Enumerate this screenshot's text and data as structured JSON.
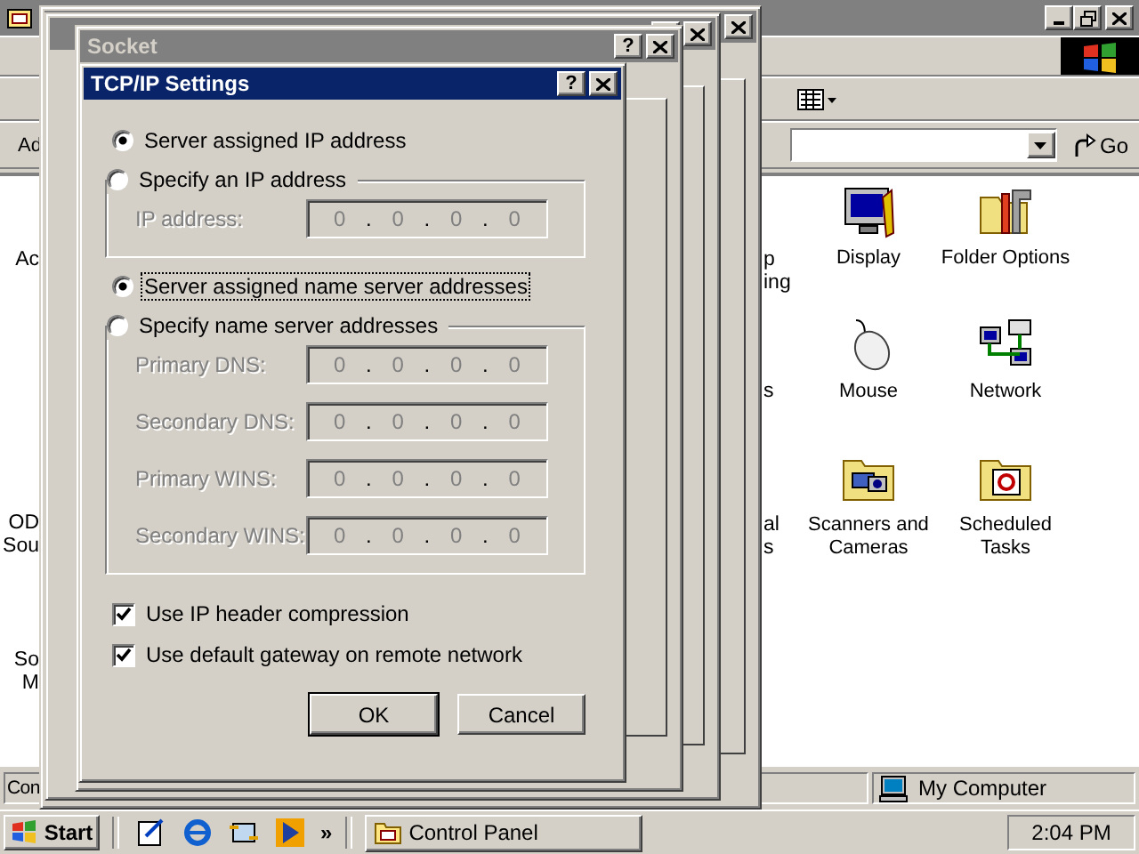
{
  "explorer": {
    "address_label": "Ad",
    "go_button": "Go",
    "icons": [
      {
        "kind": "display",
        "label": "Display"
      },
      {
        "kind": "folder-options",
        "label": "Folder Options"
      },
      {
        "kind": "mouse",
        "label": "Mouse"
      },
      {
        "kind": "network",
        "label": "Network"
      },
      {
        "kind": "scanner",
        "label": "Scanners and Cameras"
      },
      {
        "kind": "scheduled",
        "label": "Scheduled Tasks"
      }
    ],
    "left_cut_labels": [
      [
        "Ac"
      ],
      [
        "OD",
        "Sou"
      ],
      [
        "So",
        "M"
      ]
    ],
    "middle_cut_labels": [
      [
        "p",
        "ing"
      ],
      [
        "s"
      ],
      [
        "al",
        "s"
      ]
    ],
    "status": [
      "Con",
      "My Computer"
    ]
  },
  "back_windows": [
    {
      "help_button": false
    },
    {
      "help_button": true
    },
    {
      "help_button": true,
      "title": "Socket"
    }
  ],
  "dialog": {
    "title": "TCP/IP Settings",
    "help_button": "?",
    "groups": [
      {
        "options": [
          {
            "label": "Server assigned IP address",
            "selected": true,
            "focused": false
          },
          {
            "label": "Specify an IP address",
            "selected": false,
            "focused": false
          }
        ],
        "fields": [
          {
            "label": "IP address:",
            "disabled": true,
            "octets": [
              "0",
              "0",
              "0",
              "0"
            ],
            "separators": [
              ".",
              ".",
              "."
            ]
          }
        ]
      },
      {
        "options": [
          {
            "label": "Server assigned name server addresses",
            "selected": true,
            "focused": true
          },
          {
            "label": "Specify name server addresses",
            "selected": false,
            "focused": false
          }
        ],
        "fields": [
          {
            "label": "Primary DNS:",
            "disabled": true,
            "octets": [
              "0",
              "0",
              "0",
              "0"
            ],
            "separators": [
              ".",
              ".",
              "."
            ]
          },
          {
            "label": "Secondary DNS:",
            "disabled": true,
            "octets": [
              "0",
              "0",
              "0",
              "0"
            ],
            "separators": [
              ".",
              ".",
              "."
            ]
          },
          {
            "label": "Primary WINS:",
            "disabled": true,
            "octets": [
              "0",
              "0",
              "0",
              "0"
            ],
            "separators": [
              ".",
              ".",
              "."
            ]
          },
          {
            "label": "Secondary WINS:",
            "disabled": true,
            "octets": [
              "0",
              "0",
              "0",
              "0"
            ],
            "separators": [
              ".",
              ".",
              "."
            ]
          }
        ]
      }
    ],
    "checkboxes": [
      {
        "label": "Use IP header compression",
        "checked": true
      },
      {
        "label": "Use default gateway on remote network",
        "checked": true
      }
    ],
    "buttons": [
      "OK",
      "Cancel"
    ]
  },
  "taskbar": {
    "start": "Start",
    "more": "»",
    "tasks": [
      {
        "label": "Control Panel",
        "selected": false
      }
    ],
    "clock": "2:04 PM"
  }
}
